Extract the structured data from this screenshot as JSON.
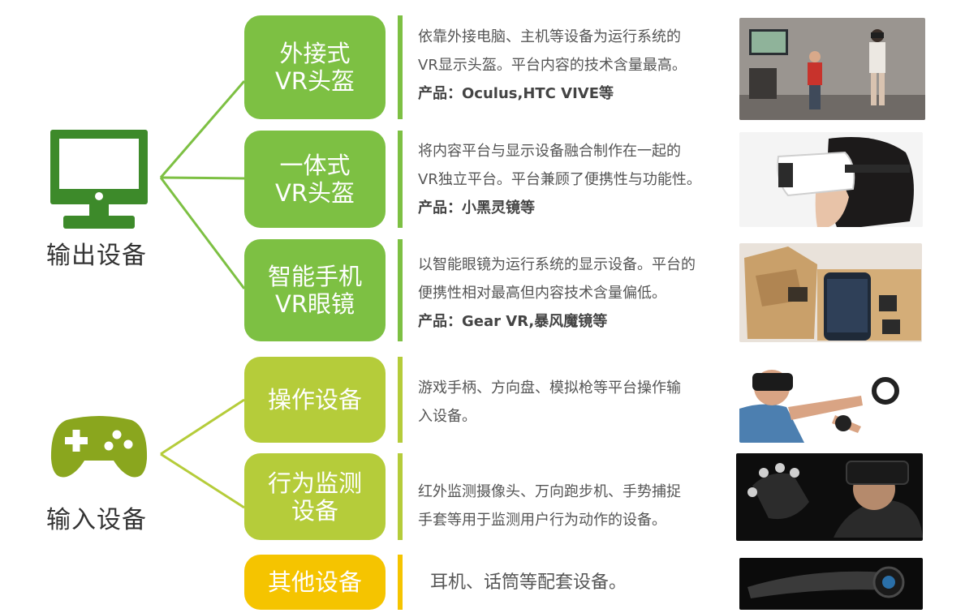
{
  "colors": {
    "green_dark": "#7dc043",
    "green_light": "#b5cc3a",
    "yellow": "#f5c400",
    "monitor_green": "#3d8a2a",
    "gamepad_green": "#8aa61e"
  },
  "categories": {
    "output": {
      "label": "输出设备",
      "icon": "monitor-icon"
    },
    "input": {
      "label": "输入设备",
      "icon": "gamepad-icon"
    }
  },
  "devices": [
    {
      "title_lines": [
        "外接式",
        "VR头盔"
      ],
      "desc_lines": [
        "依靠外接电脑、主机等设备为运行系统的",
        "VR显示头盔。平台内容的技术含量最高。"
      ],
      "product": "产品：Oculus,HTC VIVE等",
      "photo": "room-vr-demo-photo"
    },
    {
      "title_lines": [
        "一体式",
        "VR头盔"
      ],
      "desc_lines": [
        "将内容平台与显示设备融合制作在一起的",
        "VR独立平台。平台兼顾了便携性与功能性。"
      ],
      "product": "产品：小黑灵镜等",
      "photo": "woman-headset-photo"
    },
    {
      "title_lines": [
        "智能手机",
        "VR眼镜"
      ],
      "desc_lines": [
        "以智能眼镜为运行系统的显示设备。平台的",
        "便携性相对最高但内容技术含量偏低。"
      ],
      "product": "产品：Gear VR,暴风魔镜等",
      "photo": "cardboard-phone-photo"
    },
    {
      "title_lines": [
        "操作设备"
      ],
      "desc_lines": [
        "游戏手柄、方向盘、模拟枪等平台操作输",
        "入设备。"
      ],
      "product": "",
      "photo": "controller-user-photo"
    },
    {
      "title_lines": [
        "行为监测",
        "设备"
      ],
      "desc_lines": [
        "红外监测摄像头、万向跑步机、手势捕捉",
        "手套等用于监测用户行为动作的设备。"
      ],
      "product": "",
      "photo": "motion-glove-photo"
    },
    {
      "title_lines": [
        "其他设备"
      ],
      "desc_lines": [
        "耳机、话筒等配套设备。"
      ],
      "product": "",
      "photo": "headset-device-photo"
    }
  ]
}
